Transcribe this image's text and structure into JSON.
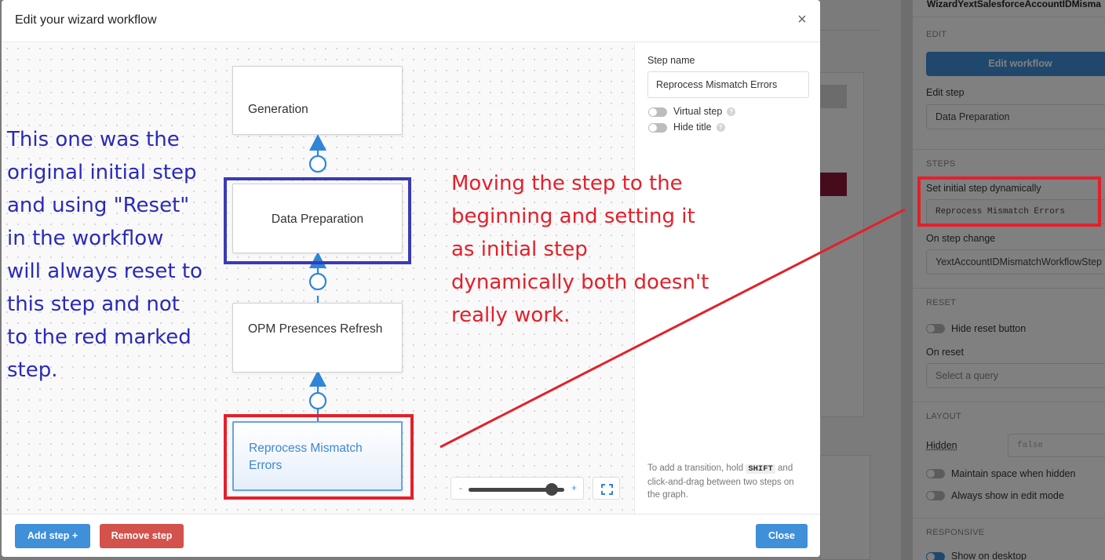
{
  "background_inspector": {
    "component_name": "WizardYextSalesforceAccountIDMisma",
    "edit": {
      "heading": "EDIT",
      "edit_workflow_button": "Edit workflow",
      "edit_step_label": "Edit step",
      "edit_step_value": "Data Preparation"
    },
    "steps": {
      "heading": "STEPS",
      "set_initial_label": "Set initial step dynamically",
      "set_initial_value": "Reprocess Mismatch Errors",
      "on_step_change_label": "On step change",
      "on_step_change_value": "YextAccountIDMismatchWorkflowStep"
    },
    "reset": {
      "heading": "RESET",
      "hide_reset_label": "Hide reset button",
      "on_reset_label": "On reset",
      "on_reset_placeholder": "Select a query"
    },
    "layout": {
      "heading": "LAYOUT",
      "hidden_label": "Hidden",
      "hidden_value": "false",
      "maintain_space_label": "Maintain space when hidden",
      "always_show_label": "Always show in edit mode"
    },
    "responsive": {
      "heading": "RESPONSIVE",
      "show_desktop_label": "Show on desktop"
    }
  },
  "modal": {
    "title": "Edit your wizard workflow",
    "close_icon": "close-icon",
    "nodes": [
      {
        "label": "Generation",
        "selected": false
      },
      {
        "label": "Data Preparation",
        "selected": false
      },
      {
        "label": "OPM Presences Refresh",
        "selected": false
      },
      {
        "label": "Reprocess Mismatch Errors",
        "selected": true
      }
    ],
    "zoom": {
      "minus": "-",
      "plus": "+",
      "level": 0.95
    },
    "fit_icon": "fullscreen-icon",
    "side": {
      "step_name_label": "Step name",
      "step_name_value": "Reprocess Mismatch Errors",
      "virtual_step_label": "Virtual step",
      "hide_title_label": "Hide title",
      "hint_part1": "To add a transition, hold",
      "hint_key": "SHIFT",
      "hint_part2": "and click-and-drag between two steps on the graph."
    },
    "footer": {
      "add_step": "Add step +",
      "remove_step": "Remove step",
      "close": "Close"
    }
  },
  "annotations": {
    "blue_text": [
      "This one was the",
      "original initial step",
      "and using \"Reset\"",
      "in the workflow",
      "will always reset to",
      "this step and not",
      "to the red marked",
      "step."
    ],
    "red_text": [
      "Moving the step to the",
      "beginning and setting it",
      "as initial step",
      "dynamically both doesn't",
      "really work."
    ],
    "colors": {
      "blue": "#2a2ab8",
      "red": "#e3202a"
    }
  }
}
